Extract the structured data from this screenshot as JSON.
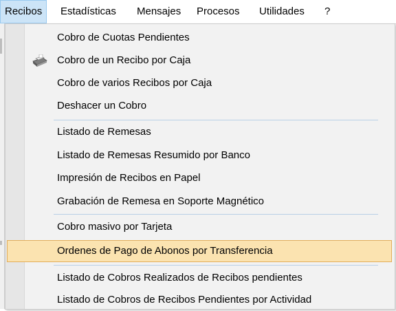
{
  "menubar": {
    "items": [
      "Recibos",
      "Estadísticas",
      "Mensajes",
      "Procesos",
      "Utilidades",
      "?"
    ]
  },
  "menu": {
    "groups": [
      [
        "Cobro de Cuotas Pendientes",
        "Cobro de un Recibo por Caja",
        "Cobro de varios Recibos por Caja",
        "Deshacer un Cobro"
      ],
      [
        "Listado de Remesas",
        "Listado de Remesas Resumido por Banco",
        "Impresión de Recibos en Papel",
        "Grabación de Remesa en Soporte Magnético"
      ],
      [
        "Cobro masivo por Tarjeta",
        "Ordenes de Pago de Abonos por Transferencia"
      ],
      [
        "Listado de Cobros Realizados de Recibos pendientes",
        "Listado de Cobros de Recibos Pendientes por Actividad"
      ]
    ],
    "highlighted": "Ordenes de Pago de Abonos por Transferencia",
    "icons": {
      "Cobro de un Recibo por Caja": "cash-register-icon"
    }
  },
  "colors": {
    "highlight_fill": "#fbe3b0",
    "highlight_border": "#e2ad5a",
    "active_menubar_fill": "#cce4f7",
    "separator": "#b9cfe6"
  }
}
